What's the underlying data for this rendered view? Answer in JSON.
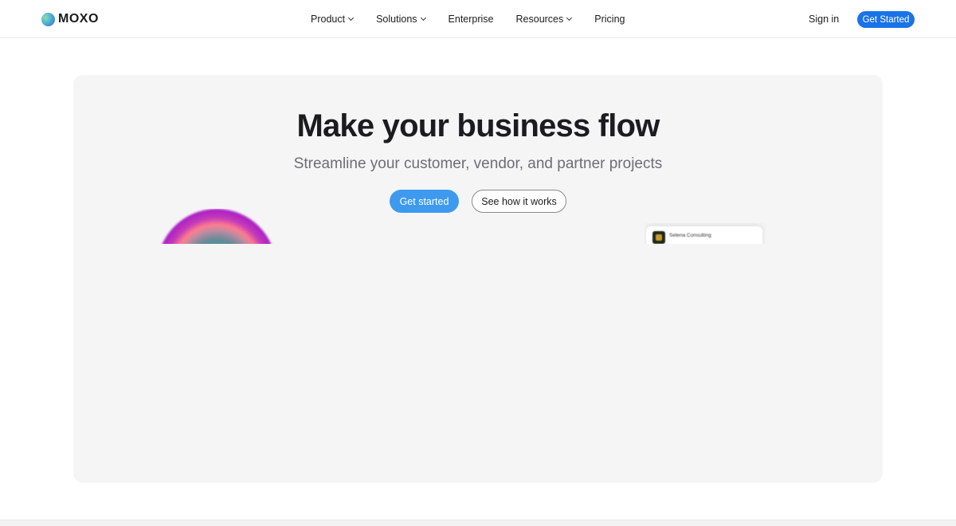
{
  "brand": {
    "name": "MOXO"
  },
  "nav": {
    "items": [
      {
        "label": "Product",
        "has_dropdown": true
      },
      {
        "label": "Solutions",
        "has_dropdown": true
      },
      {
        "label": "Enterprise",
        "has_dropdown": false
      },
      {
        "label": "Resources",
        "has_dropdown": true
      },
      {
        "label": "Pricing",
        "has_dropdown": false
      }
    ],
    "sign_in": "Sign in",
    "cta": "Get Started"
  },
  "hero": {
    "title": "Make your business flow",
    "subtitle": "Streamline your customer, vendor, and partner projects",
    "primary_button": "Get started",
    "secondary_button": "See how it works",
    "preview_card_label": "Selena Consulting"
  },
  "colors": {
    "accent": "#1a73e8",
    "primary_button": "#3d9aee",
    "hero_background": "#f5f5f5"
  }
}
